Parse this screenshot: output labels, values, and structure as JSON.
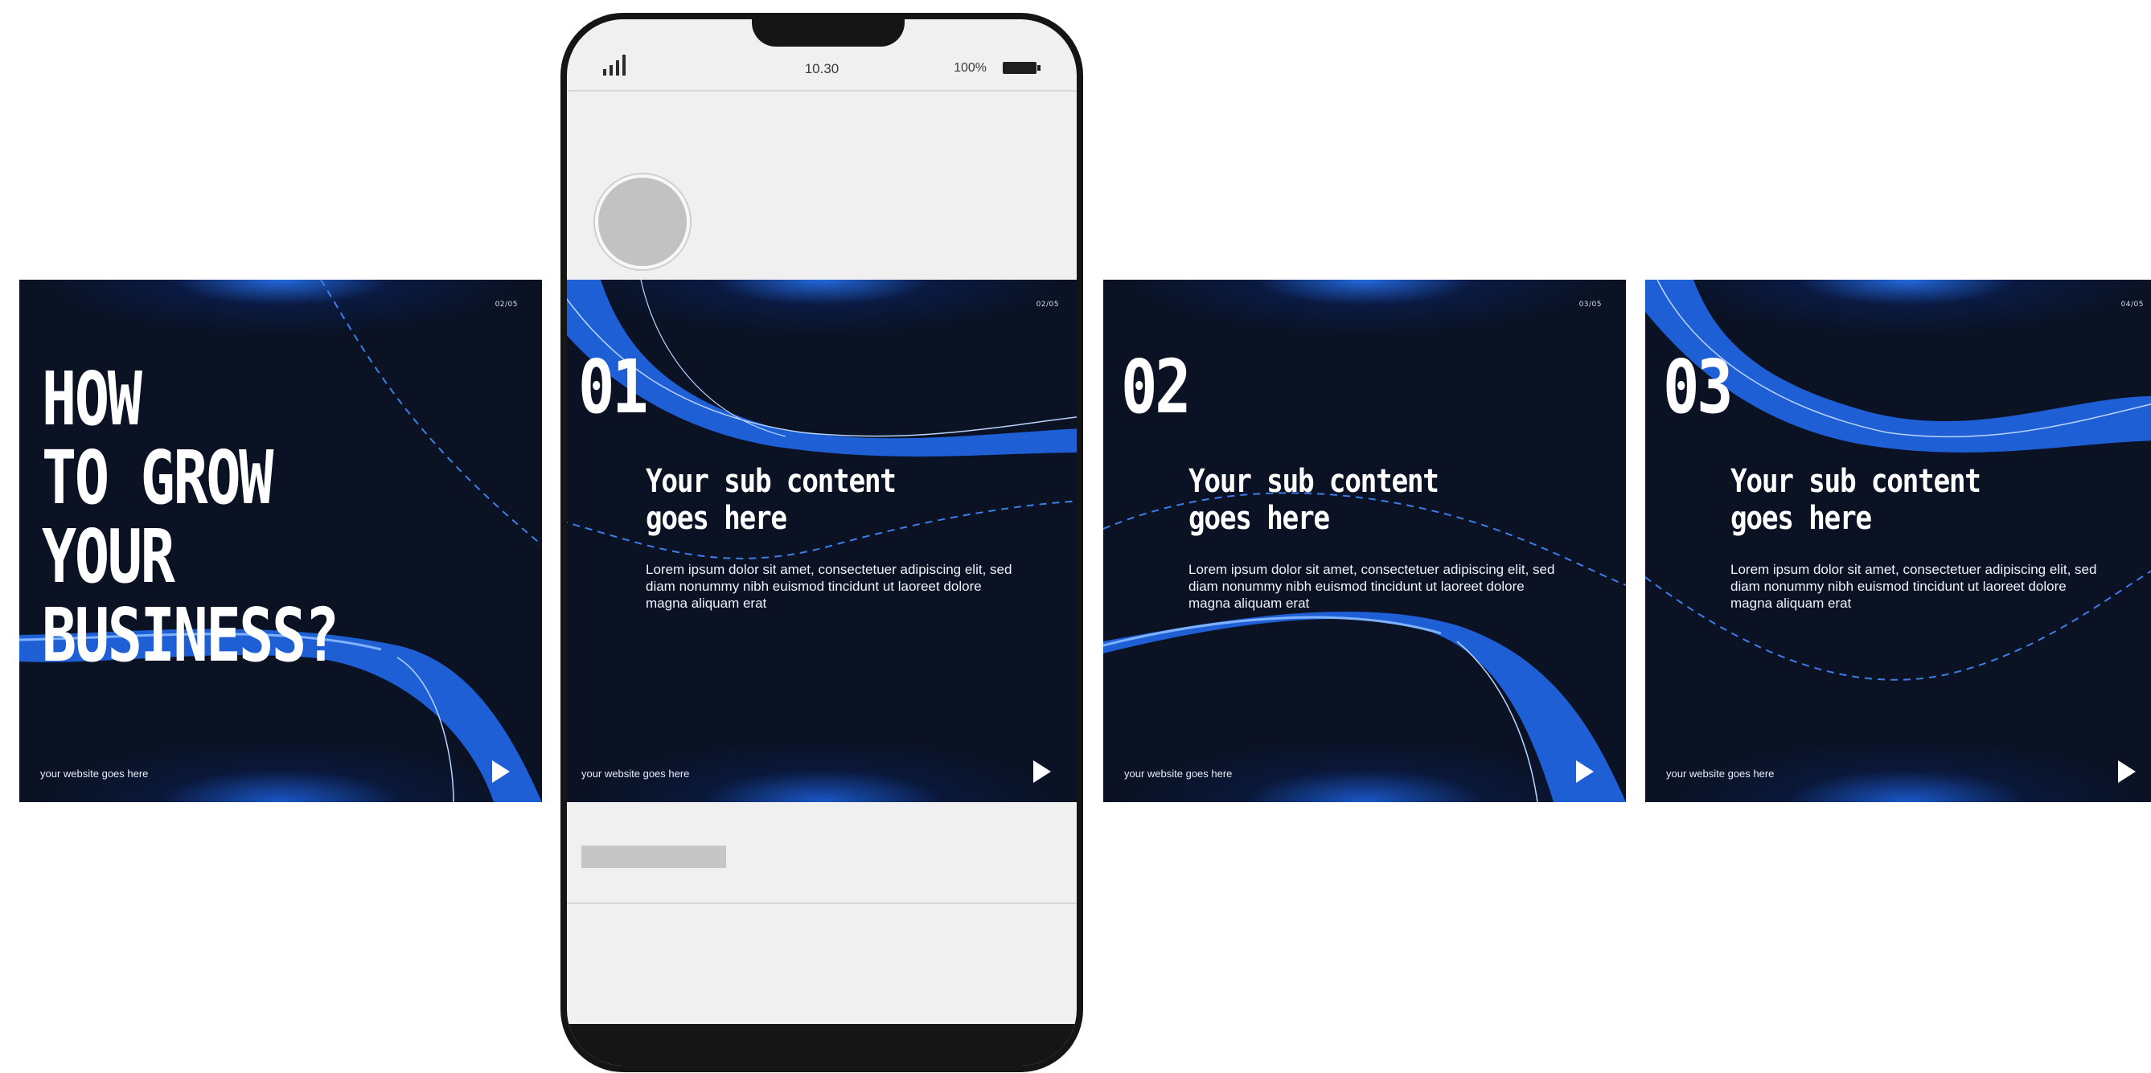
{
  "phone": {
    "status_time": "10.30",
    "battery_percent": "100%",
    "icons": [
      "signal-icon",
      "battery-icon"
    ]
  },
  "slides": [
    {
      "page": "02/05",
      "headline": [
        "HOW",
        "TO GROW",
        "YOUR",
        "BUSINESS?"
      ],
      "website": "your website goes here"
    },
    {
      "page": "02/05",
      "number": "01",
      "subtitle": [
        "Your sub content",
        "goes here"
      ],
      "body": "Lorem ipsum dolor sit amet, consectetuer adipiscing elit, sed diam nonummy nibh euismod tincidunt ut laoreet dolore magna aliquam erat",
      "website": "your website goes here"
    },
    {
      "page": "03/05",
      "number": "02",
      "subtitle": [
        "Your sub content",
        "goes here"
      ],
      "body": "Lorem ipsum dolor sit amet, consectetuer adipiscing elit, sed diam nonummy nibh euismod tincidunt ut laoreet dolore magna aliquam erat",
      "website": "your website goes here"
    },
    {
      "page": "04/05",
      "number": "03",
      "subtitle": [
        "Your sub content",
        "goes here"
      ],
      "body": "Lorem ipsum dolor sit amet, consectetuer adipiscing elit, sed diam nonummy nibh euismod tincidunt ut laoreet dolore magna aliquam erat",
      "website": "your website goes here"
    }
  ],
  "colors": {
    "slide_background": "#0a1224",
    "wave_blue": "#1f5fd6",
    "phone_frame": "#151515",
    "phone_screen": "#f0f0f0"
  }
}
